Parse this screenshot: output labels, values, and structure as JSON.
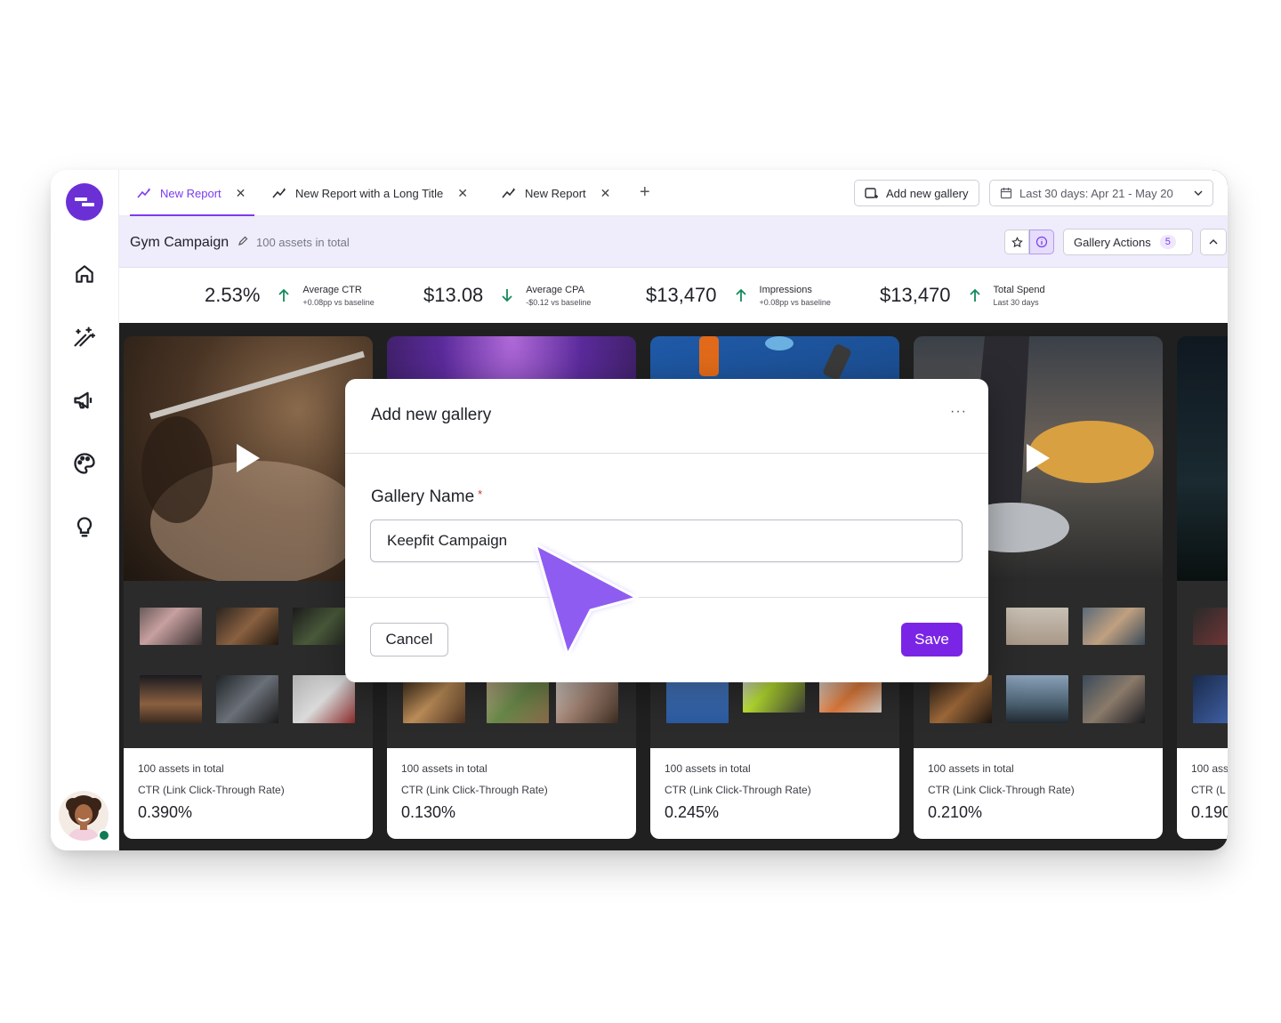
{
  "tabs": [
    {
      "label": "New Report",
      "active": true
    },
    {
      "label": "New Report with a Long Title",
      "active": false
    },
    {
      "label": "New Report",
      "active": false
    }
  ],
  "toolbar": {
    "add_gallery_label": "Add new gallery",
    "date_range_label": "Last 30 days: Apr 21 - May 20"
  },
  "campaign": {
    "title": "Gym Campaign",
    "assets_count": "100 assets in total",
    "gallery_actions_label": "Gallery Actions",
    "gallery_actions_count": "5"
  },
  "metrics": [
    {
      "value": "2.53%",
      "direction": "up",
      "title": "Average CTR",
      "subtitle": "+0.08pp vs baseline"
    },
    {
      "value": "$13.08",
      "direction": "down",
      "title": "Average CPA",
      "subtitle": "-$0.12 vs baseline"
    },
    {
      "value": "$13,470",
      "direction": "up",
      "title": "Impressions",
      "subtitle": "+0.08pp vs baseline"
    },
    {
      "value": "$13,470",
      "direction": "up",
      "title": "Total Spend",
      "subtitle": "Last 30 days"
    }
  ],
  "cards": [
    {
      "assets": "100 assets in total",
      "metric_label": "CTR (Link Click-Through Rate)",
      "metric_value": "0.390%"
    },
    {
      "assets": "100 assets in total",
      "metric_label": "CTR (Link Click-Through Rate)",
      "metric_value": "0.130%"
    },
    {
      "assets": "100 assets in total",
      "metric_label": "CTR (Link Click-Through Rate)",
      "metric_value": "0.245%"
    },
    {
      "assets": "100 assets in total",
      "metric_label": "CTR (Link Click-Through Rate)",
      "metric_value": "0.210%"
    },
    {
      "assets": "100 ass",
      "metric_label": "CTR (L",
      "metric_value": "0.190"
    }
  ],
  "modal": {
    "title": "Add new gallery",
    "more_label": "···",
    "field_label": "Gallery Name",
    "required_mark": "*",
    "field_value": "Keepfit Campaign",
    "cancel_label": "Cancel",
    "save_label": "Save"
  },
  "colors": {
    "accent": "#7a25e6",
    "positive": "#138a5a",
    "subheader_bg": "#efecfb"
  },
  "icons": [
    "home-icon",
    "sparkles-icon",
    "megaphone-icon",
    "palette-icon",
    "lightbulb-icon",
    "report-chart-icon",
    "calendar-icon",
    "star-icon",
    "info-icon",
    "pencil-icon"
  ]
}
